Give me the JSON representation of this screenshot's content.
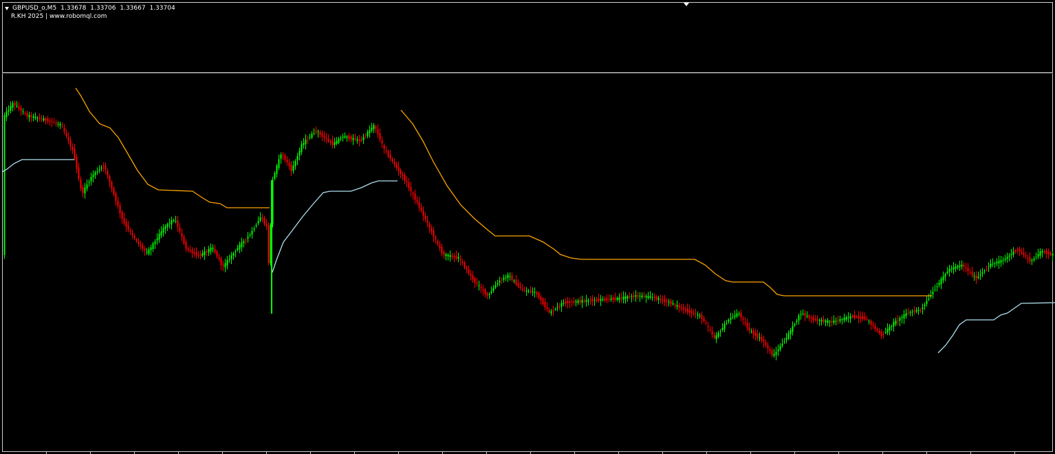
{
  "header": {
    "symbol": "GBPUSD_o,M5",
    "ohlc": [
      "1.33678",
      "1.33706",
      "1.33667",
      "1.33704"
    ],
    "indicator_label": "R.KH 2025 | www.robomql.com"
  },
  "colors": {
    "background": "#000000",
    "bull_candle": "#00ff00",
    "bear_candle": "#ff0000",
    "upper_band": "#ffa500",
    "lower_band": "#b0e0f0",
    "frame": "#d0d0d0"
  },
  "icons": {
    "dropdown": "triangle-down-icon",
    "chart_shift": "triangle-down-icon"
  }
}
